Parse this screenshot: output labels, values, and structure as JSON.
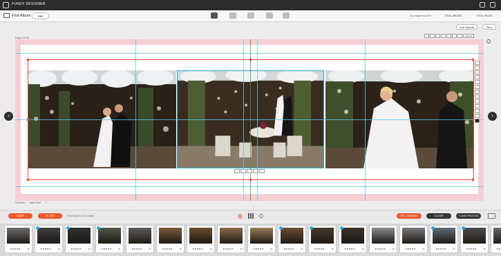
{
  "app": {
    "brand": "FUNDY DESIGNER"
  },
  "album": {
    "title": "First Album",
    "edit_label": "Edit"
  },
  "stats": {
    "images_required": "~60 images required",
    "total_images": "TOTAL IMAGES",
    "total_pages": "TOTAL PAGES"
  },
  "subbar": {
    "add_spread": "Add Spread",
    "view": "View"
  },
  "canvas": {
    "pages_label": "Pages 33-34",
    "layouts_label": "Layouts"
  },
  "checks": {
    "cut_lines": "Cut lines",
    "safe_zone": "Safe Zone",
    "help": "?"
  },
  "tray": {
    "sort": "SORT",
    "filter": "FILTER",
    "showing": "Showing 83 of 83 images",
    "fill_design": "FILL DESIGN",
    "clear": "CLEAR",
    "add_photos": "+ ADD PHOTOS"
  },
  "thumbnails": [
    {
      "tone": "#6b6b6b",
      "badged": false
    },
    {
      "tone": "#3f3f3f",
      "badged": true
    },
    {
      "tone": "#2f2f2f",
      "badged": true
    },
    {
      "tone": "#4e5a4a",
      "badged": true
    },
    {
      "tone": "#5d5d5d",
      "badged": false
    },
    {
      "tone": "#7b5a3c",
      "badged": false
    },
    {
      "tone": "#6c4c30",
      "badged": false
    },
    {
      "tone": "#8a6a48",
      "badged": false
    },
    {
      "tone": "#9a7a58",
      "badged": false
    },
    {
      "tone": "#6a4d33",
      "badged": true
    },
    {
      "tone": "#4a3a2c",
      "badged": true
    },
    {
      "tone": "#3a3028",
      "badged": true
    },
    {
      "tone": "#8c8c8c",
      "badged": false
    },
    {
      "tone": "#7a7a7a",
      "badged": false
    },
    {
      "tone": "#5e6c7a",
      "badged": true
    },
    {
      "tone": "#4c4c4c",
      "badged": true
    },
    {
      "tone": "#6a6a6a",
      "badged": false
    }
  ],
  "colors": {
    "accent": "#ec5a2c",
    "guide": "#5bc6e8",
    "selection": "#e5462f",
    "bleed": "#f5cfd3"
  },
  "icons": [
    "fundy-logo-icon",
    "help-icon",
    "export-icon",
    "album-icon",
    "design-mode-icon",
    "proof-mode-icon",
    "cards-mode-icon",
    "wall-mode-icon",
    "zoom-icon",
    "prev-spread-icon",
    "next-spread-icon",
    "settings-icon"
  ]
}
